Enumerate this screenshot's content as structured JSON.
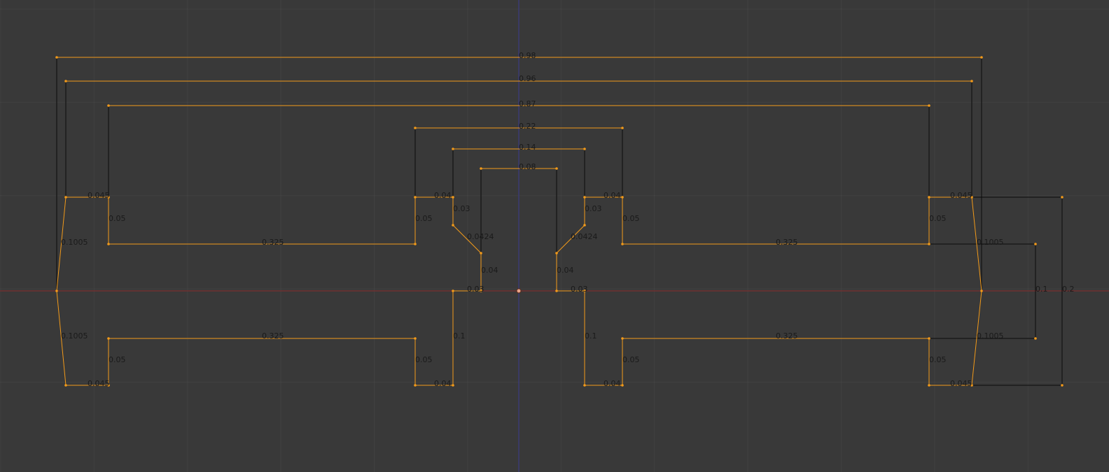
{
  "viewport": {
    "editor": "3D Viewport - Edit Mode (top orthographic)",
    "colors": {
      "background": "#393939",
      "x_axis": "#8a2a2a",
      "y_axis": "#3a3a8e",
      "selected_edge": "#f29a1a",
      "unselected_edge": "#000000",
      "label": "#1a1a1a"
    }
  },
  "edge_length_labels": [
    "0.98",
    "0.96",
    "0.87",
    "0.22",
    "0.14",
    "0.08",
    "0.045",
    "0.04",
    "0.03",
    "0.04",
    "0.03",
    "0.045",
    "0.05",
    "0.05",
    "0.05",
    "0.05",
    "0.1005",
    "0.325",
    "0.0424",
    "0.0424",
    "0.325",
    "0.1005",
    "0.04",
    "0.04",
    "0.03",
    "0.03",
    "0.1",
    "0.2",
    "0.1005",
    "0.325",
    "0.1",
    "0.1",
    "0.325",
    "0.1005",
    "0.05",
    "0.05",
    "0.05",
    "0.05",
    "0.045",
    "0.04",
    "0.04",
    "0.045"
  ]
}
